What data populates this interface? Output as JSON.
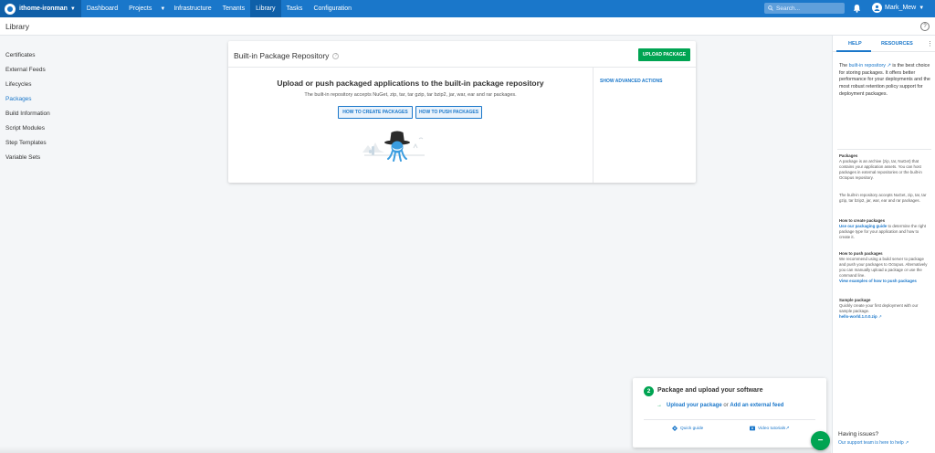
{
  "topnav": {
    "space": "ithome-ironman",
    "links": [
      "Dashboard",
      "Projects",
      "Infrastructure",
      "Tenants",
      "Library",
      "Tasks",
      "Configuration"
    ],
    "active": "Library",
    "search_placeholder": "Search...",
    "user": "Mark_Mew"
  },
  "page": {
    "title": "Library"
  },
  "sidebar": {
    "items": [
      "Certificates",
      "External Feeds",
      "Lifecycles",
      "Packages",
      "Build Information",
      "Script Modules",
      "Step Templates",
      "Variable Sets"
    ],
    "active": "Packages"
  },
  "card": {
    "title": "Built-in Package Repository",
    "upload_button": "UPLOAD PACKAGE",
    "empty_title": "Upload or push packaged applications to the built-in package repository",
    "empty_desc": "The built-in repository accepts NuGet, zip, tar, tar gzip, tar bzip2, jar, war, ear and rar packages.",
    "create_button": "HOW TO CREATE PACKAGES",
    "push_button": "HOW TO PUSH PACKAGES",
    "advanced_actions": "SHOW ADVANCED ACTIONS"
  },
  "help_panel": {
    "tab_help": "HELP",
    "tab_resources": "RESOURCES",
    "intro_pre": "The ",
    "intro_link": "built-in repository",
    "intro_post": " is the best choice for storing packages. It offers better performance for your deployments and the most robust retention policy support for deployment packages.",
    "packages_heading": "Packages",
    "packages_text": "A package is an archive (zip, tar, NuGet) that contains your application assets. You can host packages in external repositories or the built-in Octopus repository.",
    "packages_text2": "The built-in repository accepts NuGet, zip, tar, tar gzip, tar bzip2, jar, war, ear and rar packages.",
    "create_heading": "How to create packages",
    "create_link": "Use our packaging guide",
    "create_text": " to determine the right package type for your application and how to create it.",
    "push_heading": "How to push packages",
    "push_text": "We recommend using a build server to package and push your packages to Octopus. Alternatively you can manually upload a package or use the command line.",
    "push_link": "View examples of how to push packages",
    "sample_heading": "Sample package",
    "sample_text": "Quickly create your first deployment with our sample package.",
    "sample_link": "hello-world.1.0.0.zip",
    "issues_heading": "Having issues?",
    "issues_link": "Our support team is here to help"
  },
  "onboarding": {
    "step": "2",
    "title": "Package and upload your software",
    "link1": "Upload your package",
    "or": " or ",
    "link2": "Add an external feed",
    "quick_guide": "Quick guide",
    "video": "Video tutorials",
    "fab": "−"
  },
  "colors": {
    "nav": "#1a77ca",
    "accent": "#00a452",
    "link": "#1a77ca"
  }
}
